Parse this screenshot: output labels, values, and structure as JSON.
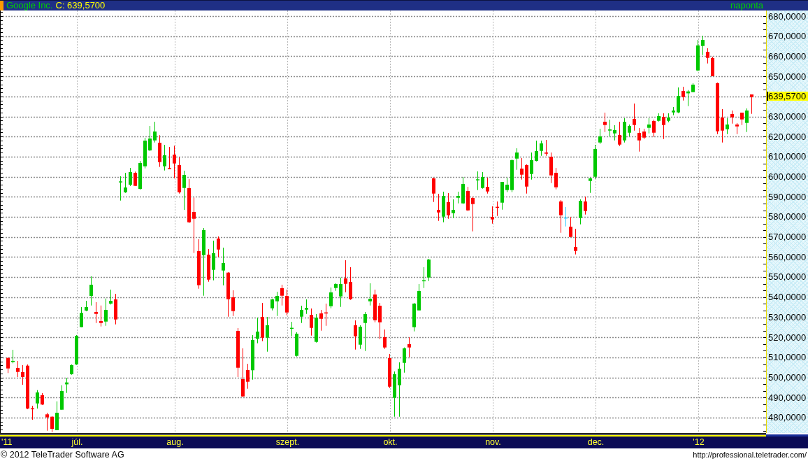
{
  "title_bar": {
    "instrument": "Google Inc.",
    "close": "C: 639,5700",
    "period": "naponta"
  },
  "y_axis": {
    "labels": [
      {
        "kind": "tick",
        "text": "680,0000"
      },
      {
        "kind": "tick",
        "text": "670,0000"
      },
      {
        "kind": "tick",
        "text": "660,0000"
      },
      {
        "kind": "tick",
        "text": "650,0000"
      },
      {
        "kind": "last_price",
        "text": "639,5700"
      },
      {
        "kind": "tick",
        "text": "630,0000"
      },
      {
        "kind": "tick",
        "text": "620,0000"
      },
      {
        "kind": "tick",
        "text": "610,0000"
      },
      {
        "kind": "tick",
        "text": "600,0000"
      },
      {
        "kind": "tick",
        "text": "590,0000"
      },
      {
        "kind": "tick",
        "text": "580,0000"
      },
      {
        "kind": "tick",
        "text": "570,0000"
      },
      {
        "kind": "tick",
        "text": "560,0000"
      },
      {
        "kind": "tick",
        "text": "550,0000"
      },
      {
        "kind": "tick",
        "text": "540,0000"
      },
      {
        "kind": "tick",
        "text": "530,0000"
      },
      {
        "kind": "tick",
        "text": "520,0000"
      },
      {
        "kind": "tick",
        "text": "510,0000"
      },
      {
        "kind": "tick",
        "text": "500,0000"
      },
      {
        "kind": "tick",
        "text": "490,0000"
      },
      {
        "kind": "tick",
        "text": "480,0000"
      }
    ]
  },
  "x_axis": {
    "labels": [
      "'11",
      "júl.",
      "aug.",
      "szept.",
      "okt.",
      "nov.",
      "dec.",
      "'12"
    ]
  },
  "footer": {
    "copyright": "© 2012 TeleTrader Software AG",
    "url": "http://professional.teletrader.com/"
  }
}
